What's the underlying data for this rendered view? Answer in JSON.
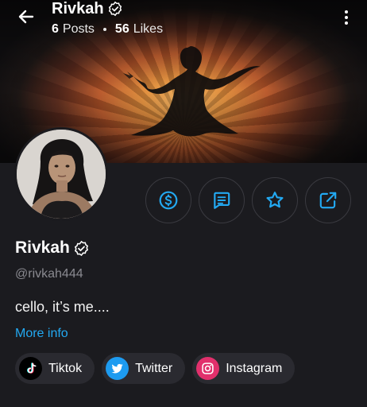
{
  "header": {
    "name": "Rivkah",
    "posts_count": "6",
    "posts_label": "Posts",
    "likes_count": "56",
    "likes_label": "Likes"
  },
  "profile": {
    "name": "Rivkah",
    "handle": "@rivkah444",
    "bio": "cello, it’s me....",
    "more_info": "More info"
  },
  "actions": [
    {
      "icon": "dollar-icon"
    },
    {
      "icon": "message-icon"
    },
    {
      "icon": "star-icon"
    },
    {
      "icon": "share-icon"
    }
  ],
  "social_links": [
    {
      "label": "Tiktok",
      "icon": "tiktok-icon",
      "color": "#000000"
    },
    {
      "label": "Twitter",
      "icon": "twitter-icon",
      "color": "#1d9bf0"
    },
    {
      "label": "Instagram",
      "icon": "instagram-icon",
      "color": "#e1306c"
    }
  ],
  "colors": {
    "accent": "#23a9f2",
    "background": "#1b1b1f",
    "chip": "#2a2a30"
  }
}
